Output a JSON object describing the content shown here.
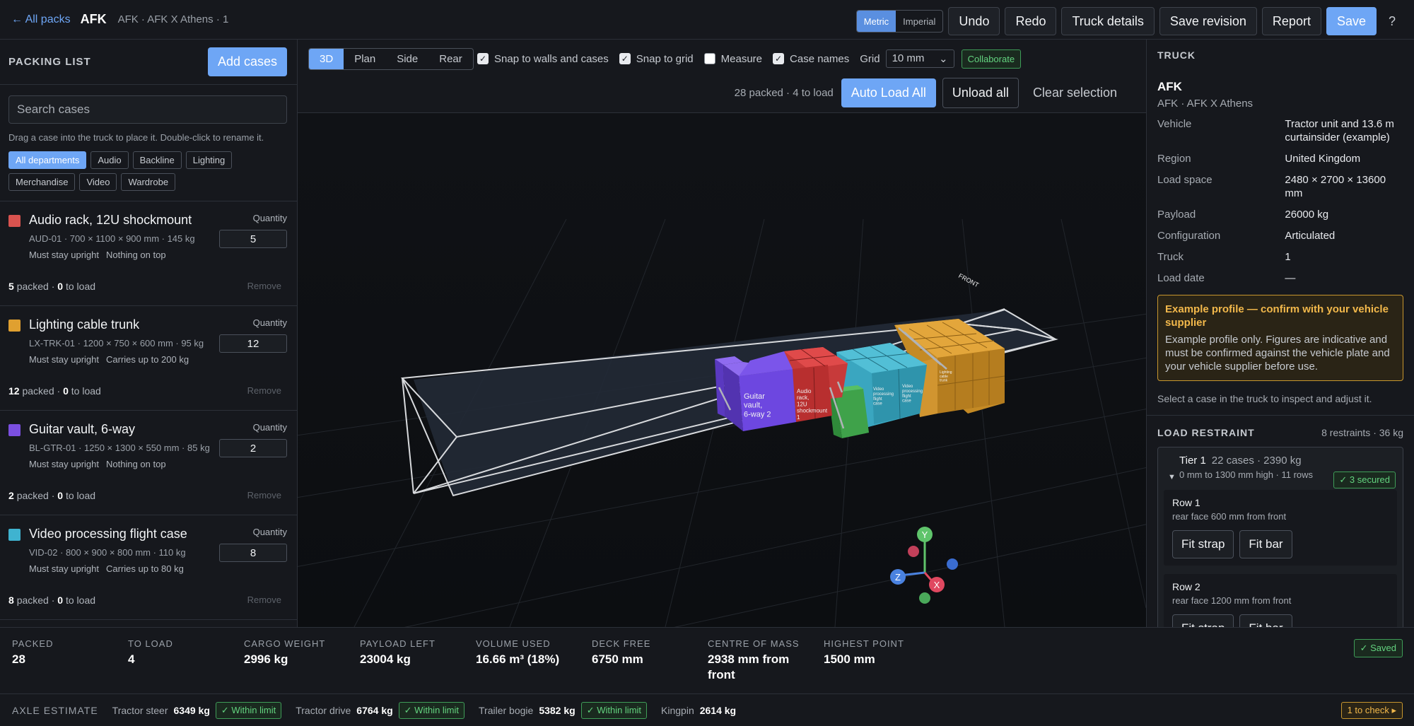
{
  "header": {
    "back": "← All packs",
    "name": "AFK",
    "crumb": "AFK · AFK X Athens · 1",
    "units": {
      "metric": "Metric",
      "imperial": "Imperial"
    },
    "buttons": {
      "undo": "Undo",
      "redo": "Redo",
      "truck": "Truck details",
      "revision": "Save revision",
      "report": "Report",
      "save": "Save",
      "help": "?"
    }
  },
  "packing": {
    "title": "PACKING LIST",
    "add": "Add cases",
    "search_placeholder": "Search cases",
    "hint": "Drag a case into the truck to place it. Double-click to rename it.",
    "departments": [
      "All departments",
      "Audio",
      "Backline",
      "Lighting",
      "Merchandise",
      "Video",
      "Wardrobe"
    ],
    "qty_label": "Quantity",
    "remove": "Remove",
    "packed_word": "packed",
    "to_load_word": "to load",
    "cases": [
      {
        "name": "Audio rack, 12U shockmount",
        "info": "AUD-01 · 700 × 1100 × 900 mm · 145 kg",
        "tags": [
          "Must stay upright",
          "Nothing on top"
        ],
        "qty": "5",
        "packed": "5",
        "toload": "0",
        "color": "#d9534f"
      },
      {
        "name": "Lighting cable trunk",
        "info": "LX-TRK-01 · 1200 × 750 × 600 mm · 95 kg",
        "tags": [
          "Must stay upright",
          "Carries up to 200 kg"
        ],
        "qty": "12",
        "packed": "12",
        "toload": "0",
        "color": "#e0a030"
      },
      {
        "name": "Guitar vault, 6-way",
        "info": "BL-GTR-01 · 1250 × 1300 × 550 mm · 85 kg",
        "tags": [
          "Must stay upright",
          "Nothing on top"
        ],
        "qty": "2",
        "packed": "2",
        "toload": "0",
        "color": "#7b4fe0"
      },
      {
        "name": "Video processing flight case",
        "info": "VID-02 · 800 × 900 × 800 mm · 110 kg",
        "tags": [
          "Must stay upright",
          "Carries up to 80 kg"
        ],
        "qty": "8",
        "packed": "8",
        "toload": "0",
        "color": "#3fb3d0"
      }
    ]
  },
  "viewer": {
    "tabs": [
      "3D",
      "Plan",
      "Side",
      "Rear"
    ],
    "options": [
      {
        "label": "Snap to walls and cases",
        "checked": true
      },
      {
        "label": "Snap to grid",
        "checked": true
      },
      {
        "label": "Measure",
        "checked": false
      },
      {
        "label": "Case names",
        "checked": true
      }
    ],
    "grid_label": "Grid",
    "grid_value": "10 mm",
    "collaborate": "Collaborate",
    "status": "28 packed · 4 to load",
    "auto": "Auto Load All",
    "unload": "Unload all",
    "clear": "Clear selection",
    "front_label": "FRONT",
    "case_labels": {
      "guitar": "Guitar vault, 6-way 2",
      "audio": "Audio rack, 12U shockmount 1",
      "video1": "Video processing flight case",
      "video2": "Video processing flight case",
      "light": "Lighting cable trunk"
    },
    "axes": {
      "x": "X",
      "y": "Y",
      "z": "Z"
    }
  },
  "truck": {
    "title": "TRUCK",
    "name": "AFK",
    "sub": "AFK · AFK X Athens",
    "fields": [
      {
        "k": "Vehicle",
        "v": "Tractor unit and 13.6 m curtainsider (example)"
      },
      {
        "k": "Region",
        "v": "United Kingdom"
      },
      {
        "k": "Load space",
        "v": "2480 × 2700 × 13600 mm"
      },
      {
        "k": "Payload",
        "v": "26000 kg"
      },
      {
        "k": "Configuration",
        "v": "Articulated"
      },
      {
        "k": "Truck",
        "v": "1"
      },
      {
        "k": "Load date",
        "v": "—"
      }
    ],
    "warn_title": "Example profile — confirm with your vehicle supplier",
    "warn_text": "Example profile only. Figures are indicative and must be confirmed against the vehicle plate and your vehicle supplier before use.",
    "select_hint": "Select a case in the truck to inspect and adjust it."
  },
  "restraint": {
    "title": "LOAD RESTRAINT",
    "meta": "8 restraints · 36 kg",
    "tier": {
      "name": "Tier 1",
      "count": "22 cases · 2390 kg",
      "sub": "0 mm to 1300 mm high · 11 rows",
      "secured": "✓ 3 secured"
    },
    "rows": [
      {
        "name": "Row 1",
        "sub": "rear face 600 mm from front"
      },
      {
        "name": "Row 2",
        "sub": "rear face 1200 mm from front"
      }
    ],
    "strap": "Fit strap",
    "bar": "Fit bar"
  },
  "summary": {
    "metrics": [
      {
        "l": "PACKED",
        "v": "28"
      },
      {
        "l": "TO LOAD",
        "v": "4"
      },
      {
        "l": "CARGO WEIGHT",
        "v": "2996 kg"
      },
      {
        "l": "PAYLOAD LEFT",
        "v": "23004 kg"
      },
      {
        "l": "VOLUME USED",
        "v": "16.66 m³ (18%)"
      },
      {
        "l": "DECK FREE",
        "v": "6750 mm"
      },
      {
        "l": "CENTRE OF MASS",
        "v": "2938 mm from front"
      },
      {
        "l": "HIGHEST POINT",
        "v": "1500 mm"
      }
    ],
    "saved": "✓ Saved",
    "axle_label": "AXLE ESTIMATE",
    "axles": [
      {
        "n": "Tractor steer",
        "v": "6349 kg",
        "s": "✓ Within limit"
      },
      {
        "n": "Tractor drive",
        "v": "6764 kg",
        "s": "✓ Within limit"
      },
      {
        "n": "Trailer bogie",
        "v": "5382 kg",
        "s": "✓ Within limit"
      },
      {
        "n": "Kingpin",
        "v": "2614 kg",
        "s": ""
      }
    ],
    "check": "1 to check ▸"
  }
}
